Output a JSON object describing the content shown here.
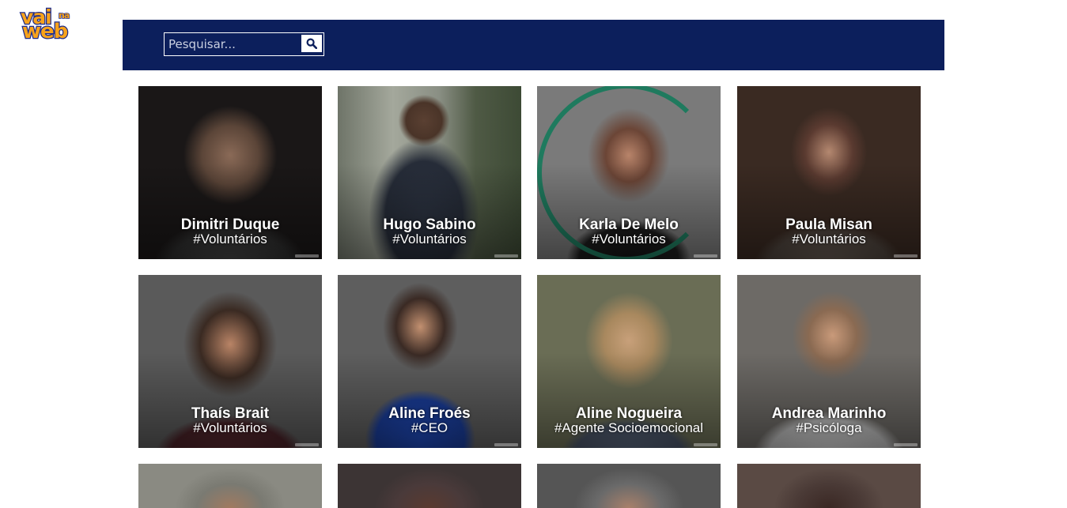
{
  "logo": {
    "line1": "vai",
    "line2": "na",
    "line3": "web"
  },
  "search": {
    "placeholder": "Pesquisar..."
  },
  "icons": {
    "search": "search-icon"
  },
  "colors": {
    "header_bg": "#0c1f5c",
    "logo_fill": "#f7a21b",
    "logo_stroke": "#1c2b8c",
    "ring": "#1f7a5e"
  },
  "people": [
    {
      "name": "Dimitri Duque",
      "tag": "#Voluntários"
    },
    {
      "name": "Hugo Sabino",
      "tag": "#Voluntários"
    },
    {
      "name": "Karla De Melo",
      "tag": "#Voluntários"
    },
    {
      "name": "Paula Misan",
      "tag": "#Voluntários"
    },
    {
      "name": "Thaís Brait",
      "tag": "#Voluntários"
    },
    {
      "name": "Aline Froés",
      "tag": "#CEO"
    },
    {
      "name": "Aline Nogueira",
      "tag": "#Agente Socioemocional"
    },
    {
      "name": "Andrea Marinho",
      "tag": "#Psicóloga"
    },
    {
      "name": "",
      "tag": ""
    },
    {
      "name": "",
      "tag": ""
    },
    {
      "name": "",
      "tag": ""
    },
    {
      "name": "",
      "tag": ""
    }
  ]
}
